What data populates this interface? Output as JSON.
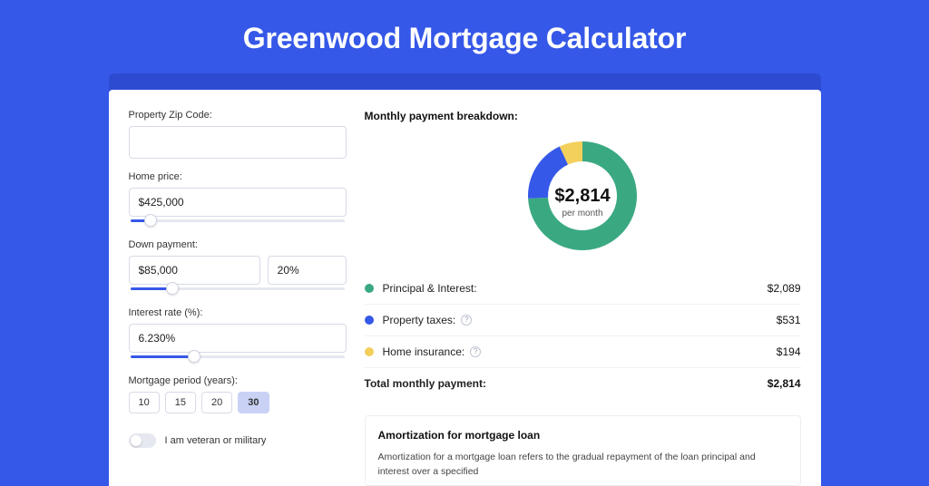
{
  "page_title": "Greenwood Mortgage Calculator",
  "colors": {
    "page_bg": "#3658e8",
    "outer_card_bg": "#2d4bd1",
    "pi": "#3aa981",
    "taxes": "#3658e8",
    "insurance": "#f3cf5b"
  },
  "form": {
    "zip_label": "Property Zip Code:",
    "zip_value": "",
    "home_price_label": "Home price:",
    "home_price_value": "$425,000",
    "home_price_slider_pct": 10,
    "down_payment_label": "Down payment:",
    "down_payment_value": "$85,000",
    "down_payment_pct_value": "20%",
    "down_payment_slider_pct": 20,
    "interest_label": "Interest rate (%):",
    "interest_value": "6.230%",
    "interest_slider_pct": 30,
    "period_label": "Mortgage period (years):",
    "period_options": [
      "10",
      "15",
      "20",
      "30"
    ],
    "period_selected_index": 3,
    "veteran_label": "I am veteran or military",
    "veteran_on": false
  },
  "breakdown": {
    "title": "Monthly payment breakdown:",
    "center_amount": "$2,814",
    "center_sub": "per month",
    "rows": [
      {
        "label": "Principal & Interest:",
        "value": "$2,089",
        "color": "#3aa981",
        "info": false
      },
      {
        "label": "Property taxes:",
        "value": "$531",
        "color": "#3658e8",
        "info": true
      },
      {
        "label": "Home insurance:",
        "value": "$194",
        "color": "#f3cf5b",
        "info": true
      }
    ],
    "total_label": "Total monthly payment:",
    "total_value": "$2,814"
  },
  "amortization": {
    "title": "Amortization for mortgage loan",
    "body": "Amortization for a mortgage loan refers to the gradual repayment of the loan principal and interest over a specified"
  },
  "chart_data": {
    "type": "pie",
    "title": "Monthly payment breakdown",
    "series": [
      {
        "name": "Principal & Interest",
        "value": 2089,
        "color": "#3aa981"
      },
      {
        "name": "Property taxes",
        "value": 531,
        "color": "#3658e8"
      },
      {
        "name": "Home insurance",
        "value": 194,
        "color": "#f3cf5b"
      }
    ],
    "total": 2814,
    "center_label": "$2,814 per month"
  }
}
